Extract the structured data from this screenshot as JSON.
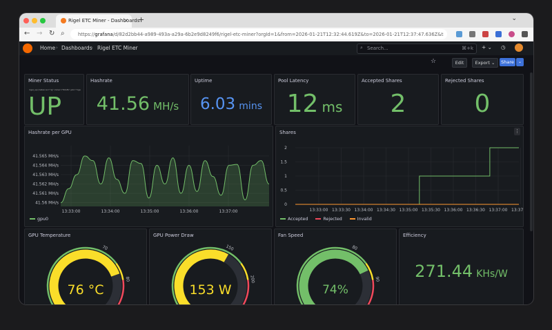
{
  "browser": {
    "tab_title": "Rigel ETC Miner - Dashboards",
    "tab_close": "×",
    "new_tab": "+",
    "url_host": "grafana",
    "url_rest": "/d/82d2bb44-a989-493a-a29a-6b2e9d8249f6/rigel-etc-miner?orgId=1&from=2026-01-21T12:32:44.619Z&to=2026-01-21T12:37:47.636Z&timezone=browser",
    "url_prefix": "https://"
  },
  "grafana": {
    "breadcrumb": [
      "Home",
      "Dashboards",
      "Rigel ETC Miner"
    ],
    "search_placeholder": "Search...",
    "search_shortcut": "⌘+k",
    "edit_label": "Edit",
    "export_label": "Export",
    "share_label": "Share"
  },
  "panels": {
    "miner_status": {
      "title": "Miner Status",
      "value": "UP",
      "note": "rigel_up{instance=\"rig\",miner=\"RIGEL\",job=\"rigel-miner\"}"
    },
    "hashrate": {
      "title": "Hashrate",
      "value": "41.56",
      "unit": "MH/s"
    },
    "uptime": {
      "title": "Uptime",
      "value": "6.03",
      "unit": "mins"
    },
    "latency": {
      "title": "Pool Latency",
      "value": "12",
      "unit": "ms"
    },
    "accepted": {
      "title": "Accepted Shares",
      "value": "2"
    },
    "rejected": {
      "title": "Rejected Shares",
      "value": "0"
    },
    "gpu_temp": {
      "title": "GPU Temperature",
      "value": "76 °C",
      "level": 0.76,
      "ticks": [
        "0",
        "70",
        "80",
        "100"
      ]
    },
    "gpu_power": {
      "title": "GPU Power Draw",
      "value": "153 W",
      "level": 0.61,
      "ticks": [
        "0",
        "150",
        "200",
        "250"
      ]
    },
    "fan": {
      "title": "Fan Speed",
      "value": "74%",
      "level": 0.74,
      "ticks": [
        "0",
        "80",
        "90",
        "100"
      ]
    },
    "efficiency": {
      "title": "Efficiency",
      "value": "271.44",
      "unit": "KHs/W"
    }
  },
  "hashrate_chart": {
    "title": "Hashrate per GPU",
    "y_ticks": [
      "41.565 MH/s",
      "41.564 MH/s",
      "41.563 MH/s",
      "41.562 MH/s",
      "41.561 MH/s",
      "41.56 MH/s"
    ],
    "x_ticks": [
      "13:33:00",
      "13:34:00",
      "13:35:00",
      "13:36:00",
      "13:37:00"
    ],
    "series_name": "gpu0",
    "values": [
      41.56,
      41.5615,
      41.563,
      41.565,
      41.5645,
      41.562,
      41.5648,
      41.5625,
      41.561,
      41.5645,
      41.5642,
      41.5605,
      41.564,
      41.562,
      41.5648,
      41.561,
      41.564,
      41.5612,
      41.5645,
      41.5628,
      41.5608,
      41.564,
      41.5641,
      41.5603,
      41.564,
      41.5645,
      41.562
    ],
    "ylim": [
      41.5596,
      41.5661
    ],
    "color": "#73bf69"
  },
  "shares_chart": {
    "title": "Shares",
    "y_ticks": [
      "2",
      "1.5",
      "1",
      "0.5",
      "0"
    ],
    "x_ticks": [
      "13:33:00",
      "13:33:30",
      "13:34:00",
      "13:34:30",
      "13:35:00",
      "13:35:30",
      "13:36:00",
      "13:36:30",
      "13:37:00",
      "13:37:30"
    ],
    "legend": [
      {
        "name": "Accepted",
        "color": "#73bf69"
      },
      {
        "name": "Rejected",
        "color": "#f2495c"
      },
      {
        "name": "Invalid",
        "color": "#ff9830"
      }
    ],
    "accepted_steps": [
      {
        "x": 0.0,
        "y": 0
      },
      {
        "x": 0.555,
        "y": 0
      },
      {
        "x": 0.555,
        "y": 1
      },
      {
        "x": 0.87,
        "y": 1
      },
      {
        "x": 0.87,
        "y": 2
      },
      {
        "x": 1.0,
        "y": 2
      }
    ]
  }
}
